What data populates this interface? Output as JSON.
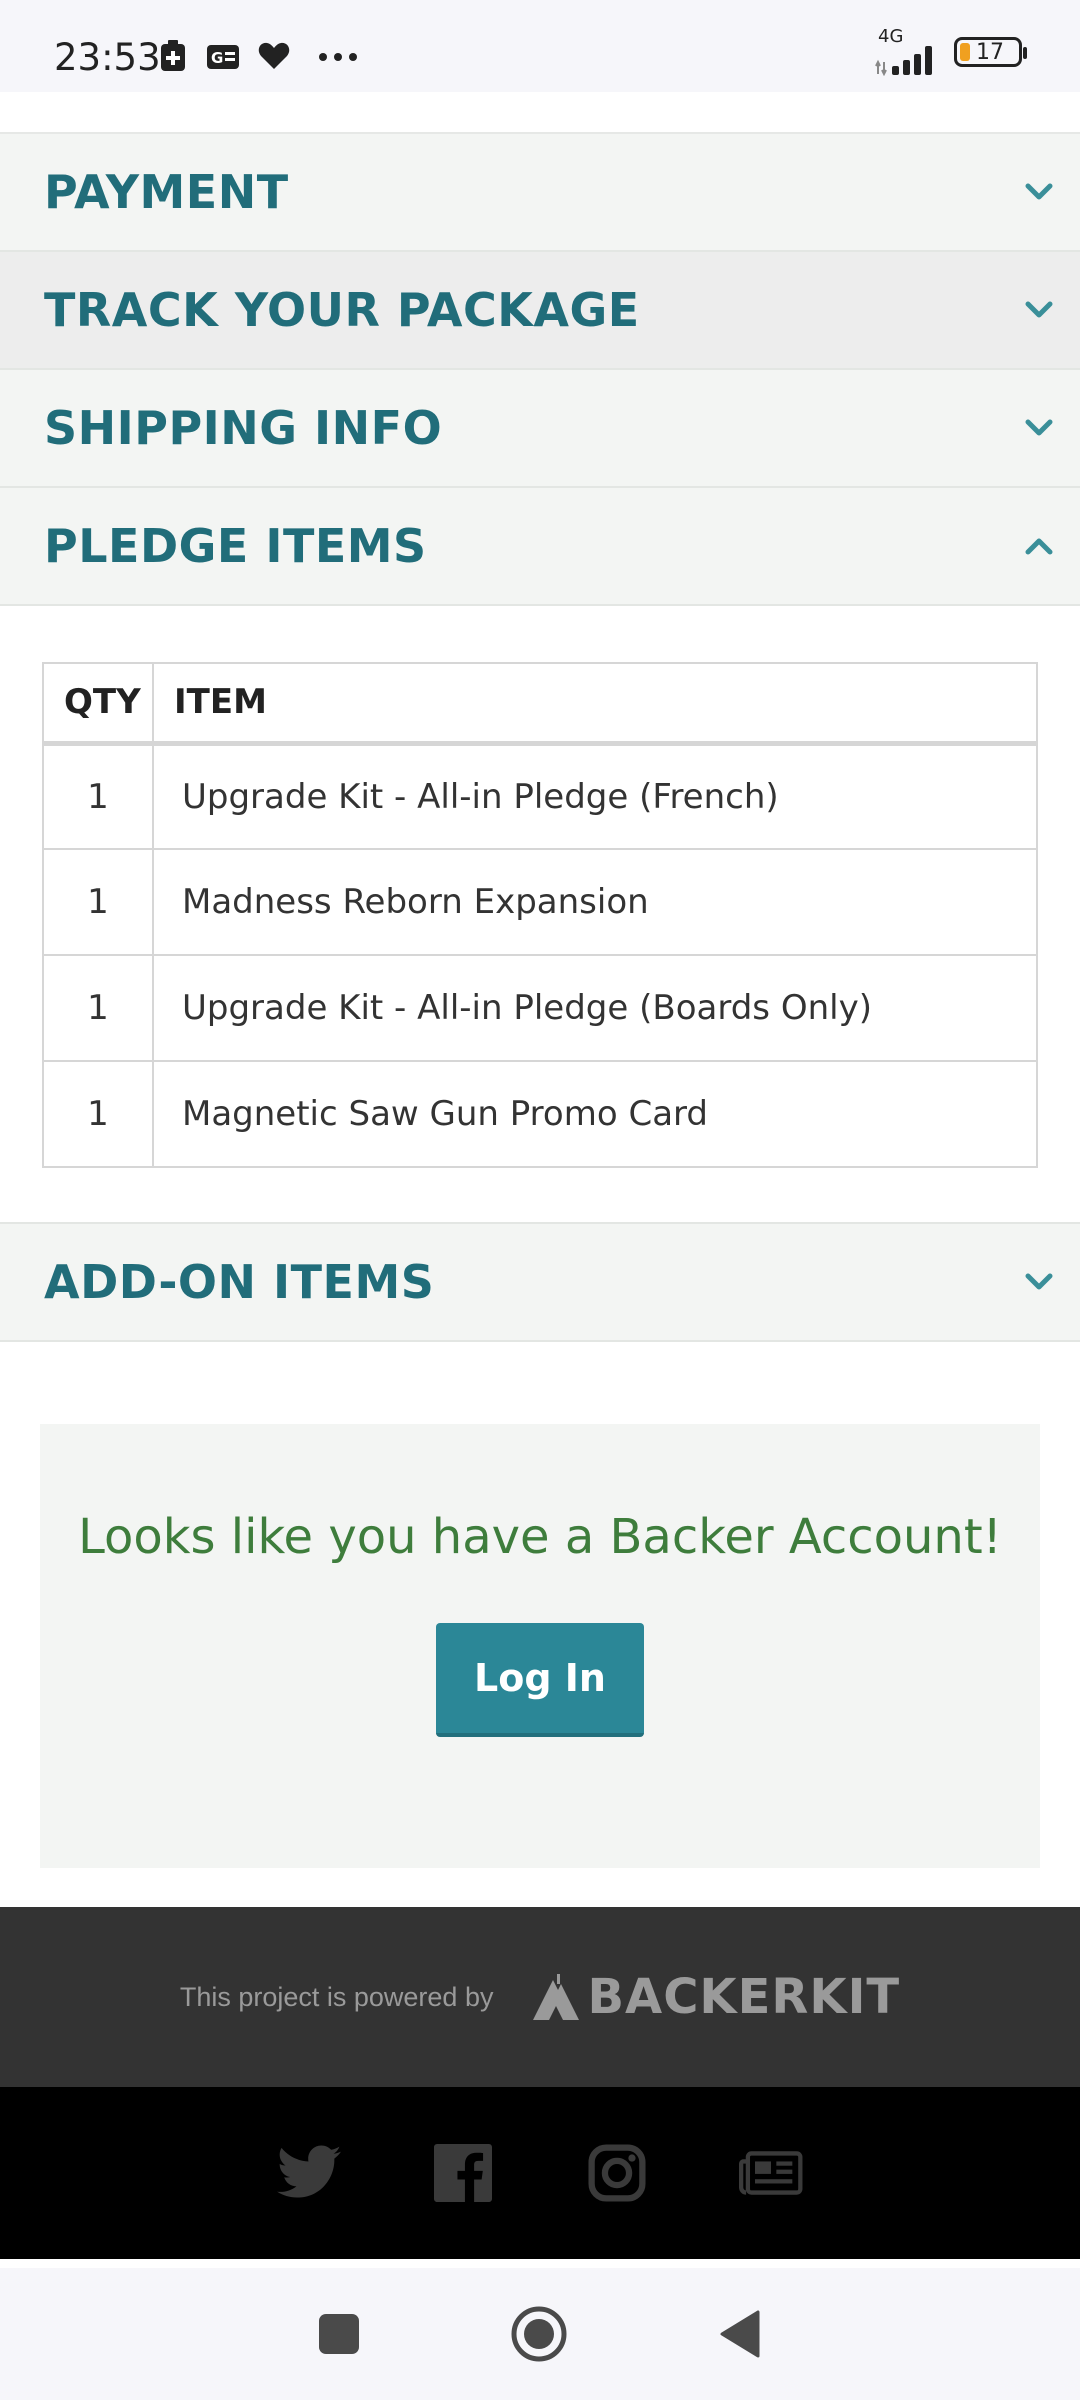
{
  "status_bar": {
    "time": "23:53",
    "network": "4G",
    "battery": "17",
    "icons": [
      "battery-saver-icon",
      "sim-card-icon",
      "heart-icon",
      "more-dots-icon",
      "signal-icon",
      "battery-icon"
    ]
  },
  "sections": {
    "payment": "PAYMENT",
    "track": "TRACK YOUR PACKAGE",
    "shipping": "SHIPPING INFO",
    "pledge": "PLEDGE ITEMS",
    "addon": "ADD-ON ITEMS"
  },
  "pledge_table": {
    "headers": {
      "qty": "QTY",
      "item": "ITEM"
    },
    "rows": [
      {
        "qty": "1",
        "item": "Upgrade Kit - All-in Pledge (French)"
      },
      {
        "qty": "1",
        "item": "Madness Reborn Expansion"
      },
      {
        "qty": "1",
        "item": "Upgrade Kit - All-in Pledge (Boards Only)"
      },
      {
        "qty": "1",
        "item": "Magnetic Saw Gun Promo Card"
      }
    ]
  },
  "backer": {
    "message": "Looks like you have a Backer Account!",
    "login_label": "Log In"
  },
  "footer": {
    "powered_by": "This project is powered by",
    "brand": "BACKERKIT",
    "social": [
      "twitter-icon",
      "facebook-icon",
      "instagram-icon",
      "news-icon"
    ]
  },
  "colors": {
    "accent": "#216d7a",
    "button": "#2b8797",
    "message_green": "#3e7d3c"
  }
}
